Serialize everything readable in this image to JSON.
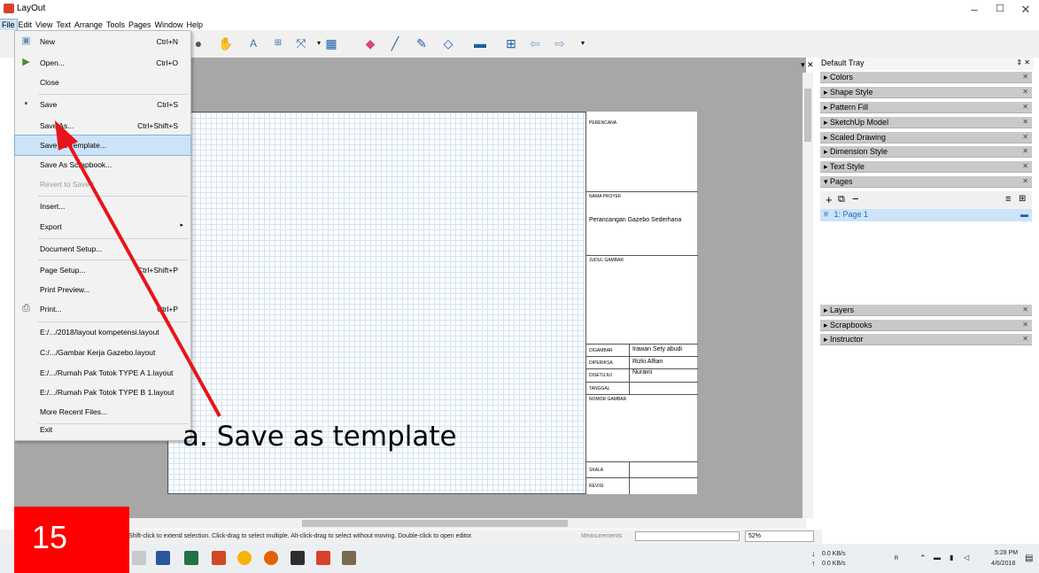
{
  "window": {
    "title": "LayOut",
    "minimize": "–",
    "maximize": "☐",
    "close": "✕"
  },
  "menubar": [
    "File",
    "Edit",
    "View",
    "Text",
    "Arrange",
    "Tools",
    "Pages",
    "Window",
    "Help"
  ],
  "file_menu": {
    "items": [
      {
        "label": "New",
        "shortcut": "Ctrl+N",
        "icon": "new-doc-icon"
      },
      {
        "label": "Open...",
        "shortcut": "Ctrl+O",
        "icon": "open-folder-icon"
      },
      {
        "label": "Close",
        "shortcut": ""
      },
      {
        "label": "Save",
        "shortcut": "Ctrl+S",
        "icon": "save-disk-icon"
      },
      {
        "label": "Save As...",
        "shortcut": "Ctrl+Shift+S"
      },
      {
        "label": "Save As Template...",
        "shortcut": ""
      },
      {
        "label": "Save As Scrapbook...",
        "shortcut": ""
      },
      {
        "label": "Revert to Saved",
        "shortcut": ""
      },
      {
        "label": "Insert...",
        "shortcut": ""
      },
      {
        "label": "Export",
        "shortcut": ""
      },
      {
        "label": "Document Setup...",
        "shortcut": ""
      },
      {
        "label": "Page Setup...",
        "shortcut": "Ctrl+Shift+P"
      },
      {
        "label": "Print Preview...",
        "shortcut": ""
      },
      {
        "label": "Print...",
        "shortcut": "Ctrl+P",
        "icon": "printer-icon"
      },
      {
        "label": "E:/.../2018/layout kompetensi.layout",
        "shortcut": ""
      },
      {
        "label": "C:/.../Gambar Kerja Gazebo.layout",
        "shortcut": ""
      },
      {
        "label": "E:/.../Rumah Pak Totok TYPE A 1.layout",
        "shortcut": ""
      },
      {
        "label": "E:/.../Rumah Pak Totok TYPE B 1.layout",
        "shortcut": ""
      },
      {
        "label": "More Recent Files...",
        "shortcut": ""
      },
      {
        "label": "Exit",
        "shortcut": ""
      }
    ]
  },
  "title_block": {
    "perencana_label": "PERENCANA",
    "nama_proyek_label": "NAMA PROYEK",
    "nama_proyek_value": "Perancangan Gazebo Sederhana",
    "judul_gambar_label": "JUDUL GAMBAR",
    "digambar_label": "DIGAMBAR",
    "digambar_value": "Irawan Sety abudi",
    "diperiksa_label": "DIPERIKSA",
    "diperiksa_value": "Rizki Alfian",
    "disetujui_label": "DISETUJUI",
    "disetujui_value": "Nuraini",
    "tanggal_label": "TANGGAL",
    "nomor_gambar_label": "NOMOR GAMBAR",
    "skala_label": "SKALA",
    "revisi_label": "REVISI"
  },
  "tray": {
    "title": "Default Tray",
    "pin": "⇕ ✕",
    "close": "▾ ✕",
    "panels": [
      "Colors",
      "Shape Style",
      "Pattern Fill",
      "SketchUp Model",
      "Scaled Drawing",
      "Dimension Style",
      "Text Style",
      "Pages"
    ],
    "lower_panels": [
      "Layers",
      "Scrapbooks",
      "Instructor"
    ],
    "page_entry": {
      "hash": "#",
      "label": "1: Page 1"
    }
  },
  "statusbar": {
    "hint": "Shift-click to extend selection. Click-drag to select multiple. Alt-click-drag to select without moving. Double-click to open editor.",
    "measurements_label": "Measurements",
    "measurements_value": "",
    "zoom": "52%"
  },
  "taskbar": {
    "net_down": "0.0 KB/s",
    "net_up": "0.0 KB/s",
    "time": "5:28 PM",
    "date": "4/6/2018"
  },
  "annotation": {
    "text": "a.   Save as template",
    "slide_number": "15"
  },
  "colors": {
    "highlight": "#cde3f7",
    "arrow": "#e8141c",
    "badge": "#ff0000"
  }
}
